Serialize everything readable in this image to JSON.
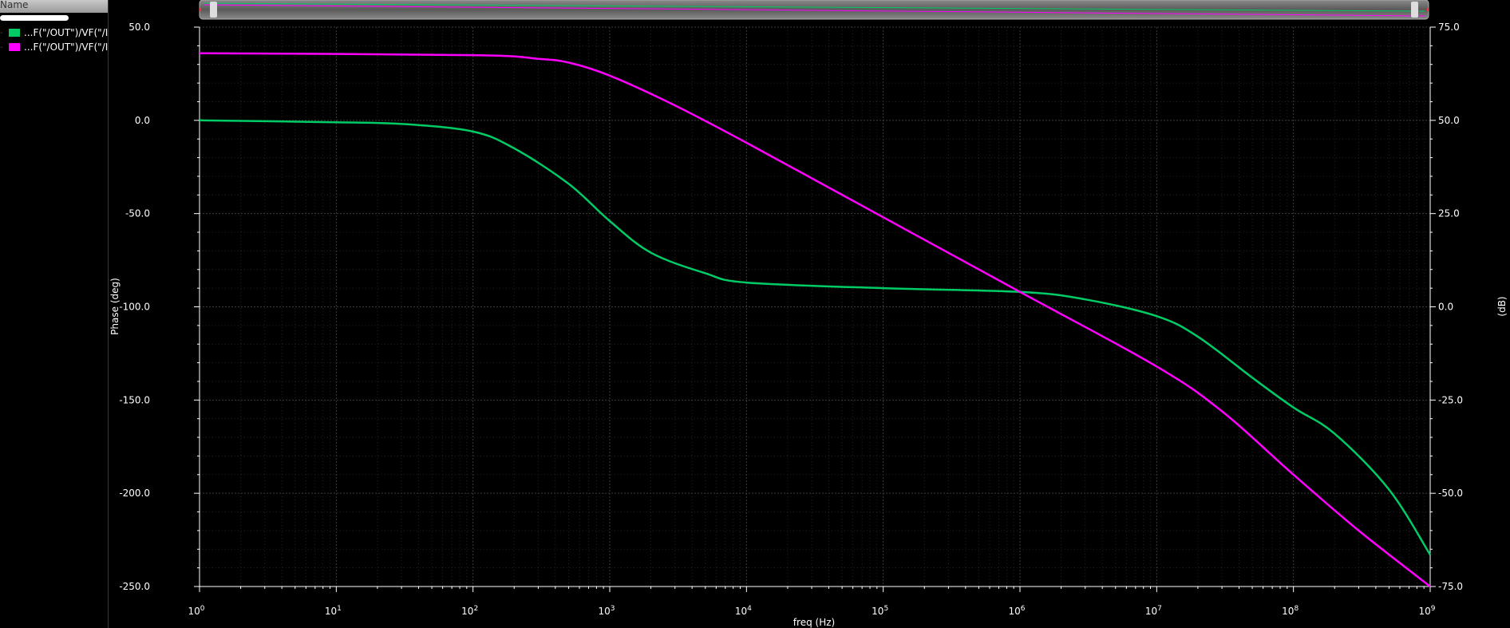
{
  "legend": {
    "header": "Name",
    "items": [
      {
        "label": "...F(\"/OUT\")/VF(\"/I",
        "color": "#00cc66"
      },
      {
        "label": "...F(\"/OUT\")/VF(\"/I",
        "color": "#ff00ff"
      }
    ]
  },
  "colors": {
    "background": "#000000",
    "grid": "#3c3c3c",
    "axis": "#ffffff",
    "phase_trace": "#00cc66",
    "magnitude_trace": "#ff00ff"
  },
  "chart_data": {
    "type": "line",
    "xscale": "log",
    "xlabel": "freq (Hz)",
    "ylabel": "Phase (deg)",
    "y2label": "(dB)",
    "xlim": [
      1,
      1000000000
    ],
    "ylim": [
      -250,
      50
    ],
    "y2lim": [
      -75,
      75
    ],
    "xticks": [
      {
        "value": 1,
        "base": "10",
        "exp": "0"
      },
      {
        "value": 10,
        "base": "10",
        "exp": "1"
      },
      {
        "value": 100,
        "base": "10",
        "exp": "2"
      },
      {
        "value": 1000,
        "base": "10",
        "exp": "3"
      },
      {
        "value": 10000,
        "base": "10",
        "exp": "4"
      },
      {
        "value": 100000,
        "base": "10",
        "exp": "5"
      },
      {
        "value": 1000000,
        "base": "10",
        "exp": "6"
      },
      {
        "value": 10000000,
        "base": "10",
        "exp": "7"
      },
      {
        "value": 100000000,
        "base": "10",
        "exp": "8"
      },
      {
        "value": 1000000000,
        "base": "10",
        "exp": "9"
      }
    ],
    "yticks": [
      "50.0",
      "0.0",
      "-50.0",
      "-100.0",
      "-150.0",
      "-200.0",
      "-250.0"
    ],
    "y2ticks": [
      "75.0",
      "50.0",
      "25.0",
      "0.0",
      "-25.0",
      "-50.0",
      "-75.0"
    ],
    "grid": true,
    "legend_position": "left-panel",
    "series": [
      {
        "axis": "left",
        "color": "#00cc66",
        "x": [
          1,
          10,
          31.6,
          100,
          200,
          500,
          1000,
          2000,
          5000,
          10000,
          100000,
          1000000,
          3000000,
          10000000,
          20000000,
          50000000,
          100000000,
          200000000,
          500000000,
          1000000000
        ],
        "y": [
          0,
          -1,
          -2,
          -6,
          -15,
          -34,
          -54,
          -71,
          -82,
          -87,
          -90,
          -92,
          -96,
          -105,
          -116,
          -138,
          -154,
          -168,
          -198,
          -233
        ]
      },
      {
        "axis": "right",
        "color": "#ff00ff",
        "x": [
          1,
          100,
          300,
          500,
          1000,
          3000,
          10000,
          100000,
          1000000,
          10000000,
          30000000,
          100000000,
          300000000,
          1000000000
        ],
        "y": [
          68,
          67.5,
          66.5,
          65.5,
          62,
          54,
          44,
          24,
          4,
          -16,
          -28,
          -45,
          -60,
          -75
        ]
      }
    ]
  }
}
